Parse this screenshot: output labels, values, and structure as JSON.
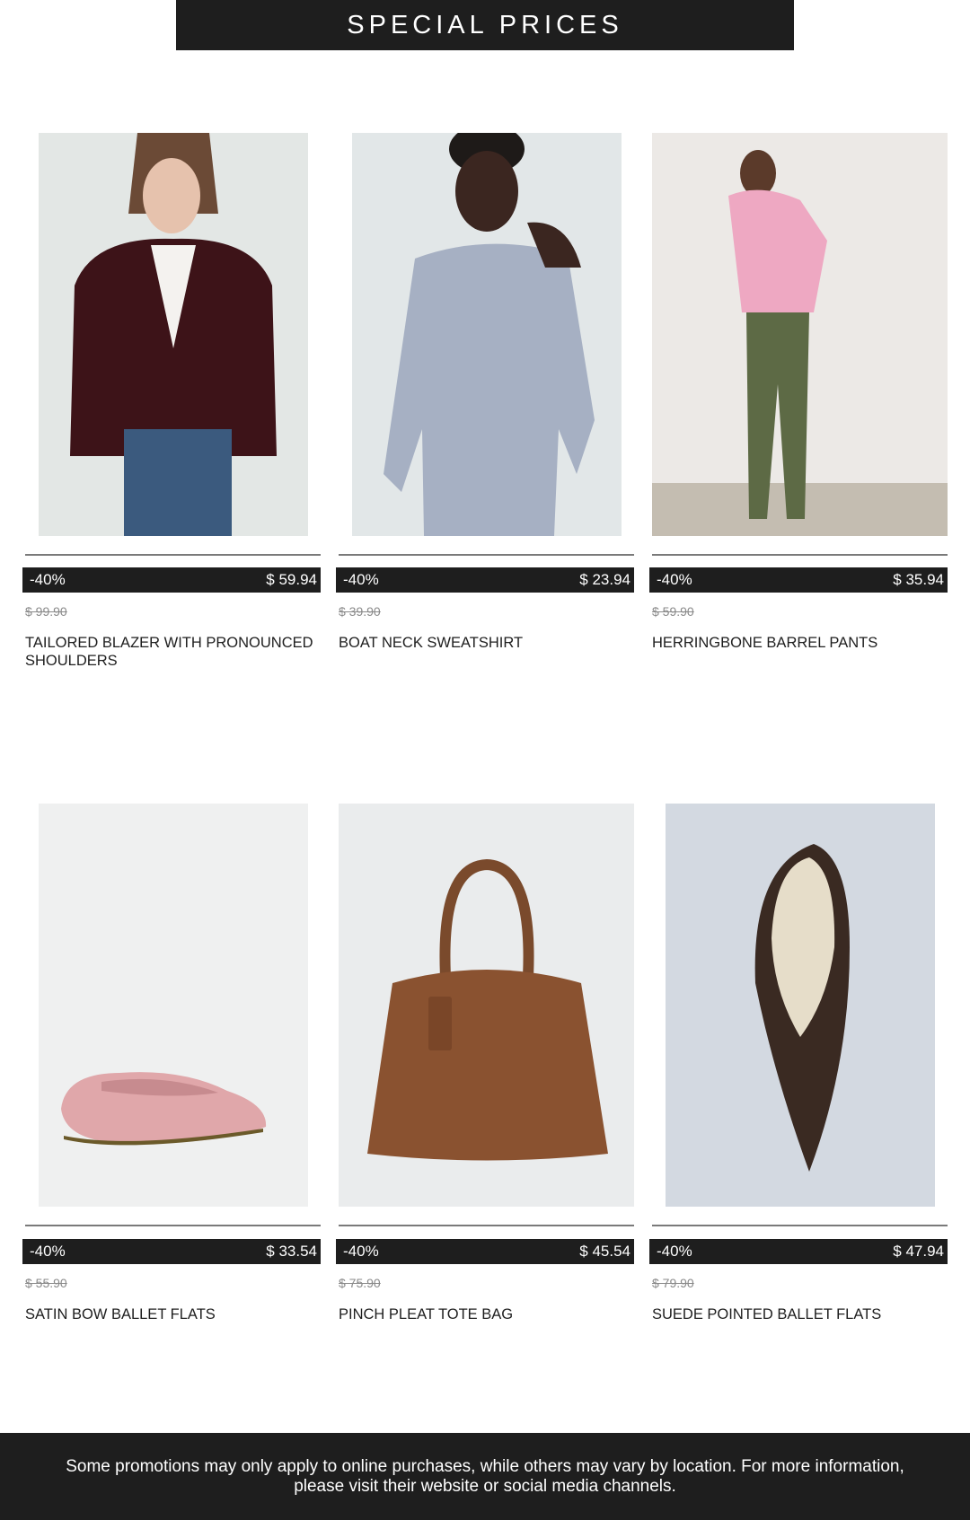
{
  "header": {
    "title": "SPECIAL PRICES"
  },
  "products": [
    {
      "discount": "-40%",
      "price": "$ 59.94",
      "old_price": "$ 99.90",
      "name": "TAILORED BLAZER WITH PRONOUNCED SHOULDERS",
      "image": "blazer-model-photo"
    },
    {
      "discount": "-40%",
      "price": "$ 23.94",
      "old_price": "$ 39.90",
      "name": "BOAT NECK SWEATSHIRT",
      "image": "sweatshirt-model-photo"
    },
    {
      "discount": "-40%",
      "price": "$ 35.94",
      "old_price": "$ 59.90",
      "name": "HERRINGBONE BARREL PANTS",
      "image": "pants-model-photo"
    },
    {
      "discount": "-40%",
      "price": "$ 33.54",
      "old_price": "$ 55.90",
      "name": "SATIN BOW BALLET FLATS",
      "image": "pink-ballet-flat-photo"
    },
    {
      "discount": "-40%",
      "price": "$ 45.54",
      "old_price": "$ 75.90",
      "name": "PINCH PLEAT TOTE BAG",
      "image": "brown-tote-bag-photo"
    },
    {
      "discount": "-40%",
      "price": "$ 47.94",
      "old_price": "$ 79.90",
      "name": "SUEDE POINTED BALLET FLATS",
      "image": "suede-pointed-flat-photo"
    }
  ],
  "footer": {
    "text": "Some promotions may only apply to online purchases, while others may vary by location. For more information, please visit their website or social media channels."
  },
  "colors": {
    "bar": "#1e1e1e",
    "background": "#ffffff",
    "strike": "#8a8a8a"
  }
}
